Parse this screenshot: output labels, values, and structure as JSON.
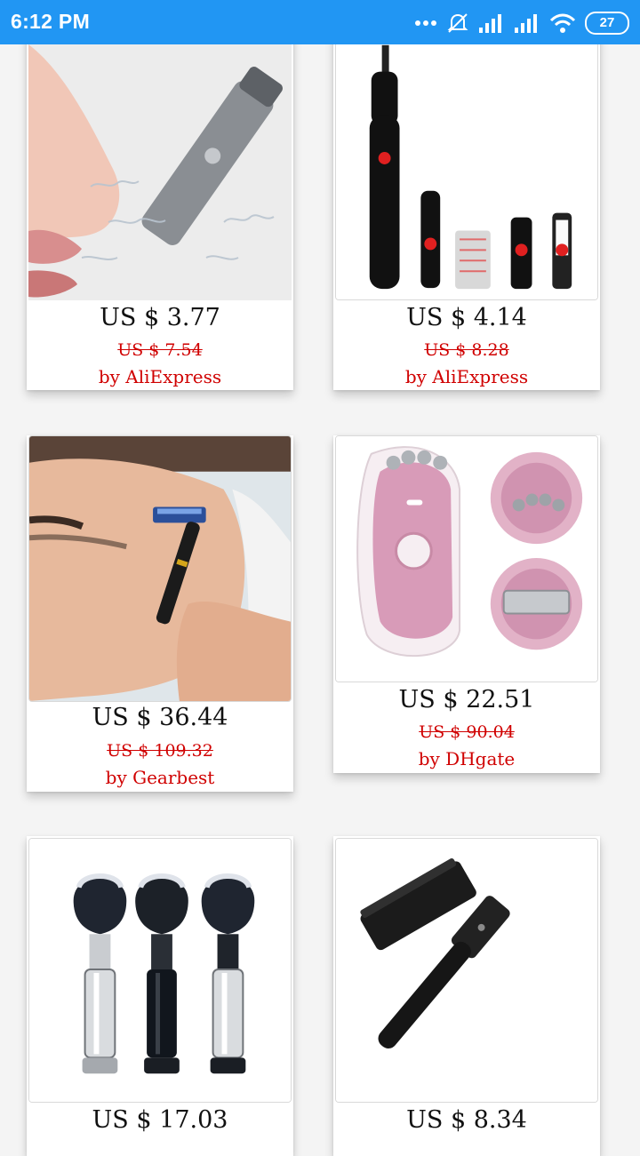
{
  "status_bar": {
    "time": "6:12 PM",
    "battery": "27",
    "icons": [
      "more-dots-icon",
      "muted-alarm-icon",
      "signal-1-icon",
      "signal-2-icon",
      "wifi-icon",
      "battery-icon"
    ]
  },
  "products": [
    {
      "price": "US $ 3.77",
      "old_price": "US $ 7.54",
      "source": "by AliExpress",
      "image": "nose-hair-trimmer-image"
    },
    {
      "price": "US $ 4.14",
      "old_price": "US $ 8.28",
      "source": "by AliExpress",
      "image": "eyebrow-trimmer-set-image"
    },
    {
      "price": "US $ 36.44",
      "old_price": "US $ 109.32",
      "source": "by Gearbest",
      "image": "man-shaving-razor-image"
    },
    {
      "price": "US $ 22.51",
      "old_price": "US $ 90.04",
      "source": "by DHgate",
      "image": "pink-epilator-image"
    },
    {
      "price": "US $ 17.03",
      "old_price": "",
      "source": "",
      "image": "shaving-brushes-image"
    },
    {
      "price": "US $ 8.34",
      "old_price": "",
      "source": "",
      "image": "safety-razor-image"
    }
  ],
  "colors": {
    "status_bar": "#2196f3",
    "discount_red": "#d00000",
    "page_background": "#f4f4f4"
  }
}
